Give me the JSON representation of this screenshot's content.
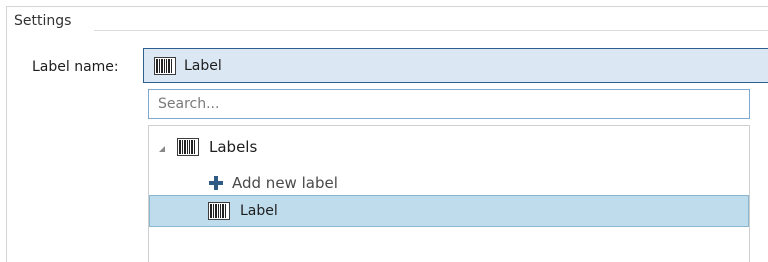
{
  "settings": {
    "group_title": "Settings",
    "label_name_caption": "Label name:",
    "selected_value": "Label",
    "selected_icon": "barcode-icon"
  },
  "search": {
    "placeholder": "Search..."
  },
  "tree": {
    "root": {
      "label": "Labels",
      "icon": "barcode-icon",
      "expanded": true
    },
    "add_item": {
      "label": "Add new label",
      "icon": "plus-icon"
    },
    "items": [
      {
        "label": "Label",
        "icon": "barcode-icon",
        "selected": true
      }
    ]
  },
  "colors": {
    "accent_border": "#2f5f8f",
    "combo_background": "#dbe8f4",
    "selection_background": "#bedcec",
    "plus_icon": "#2e5a84"
  }
}
